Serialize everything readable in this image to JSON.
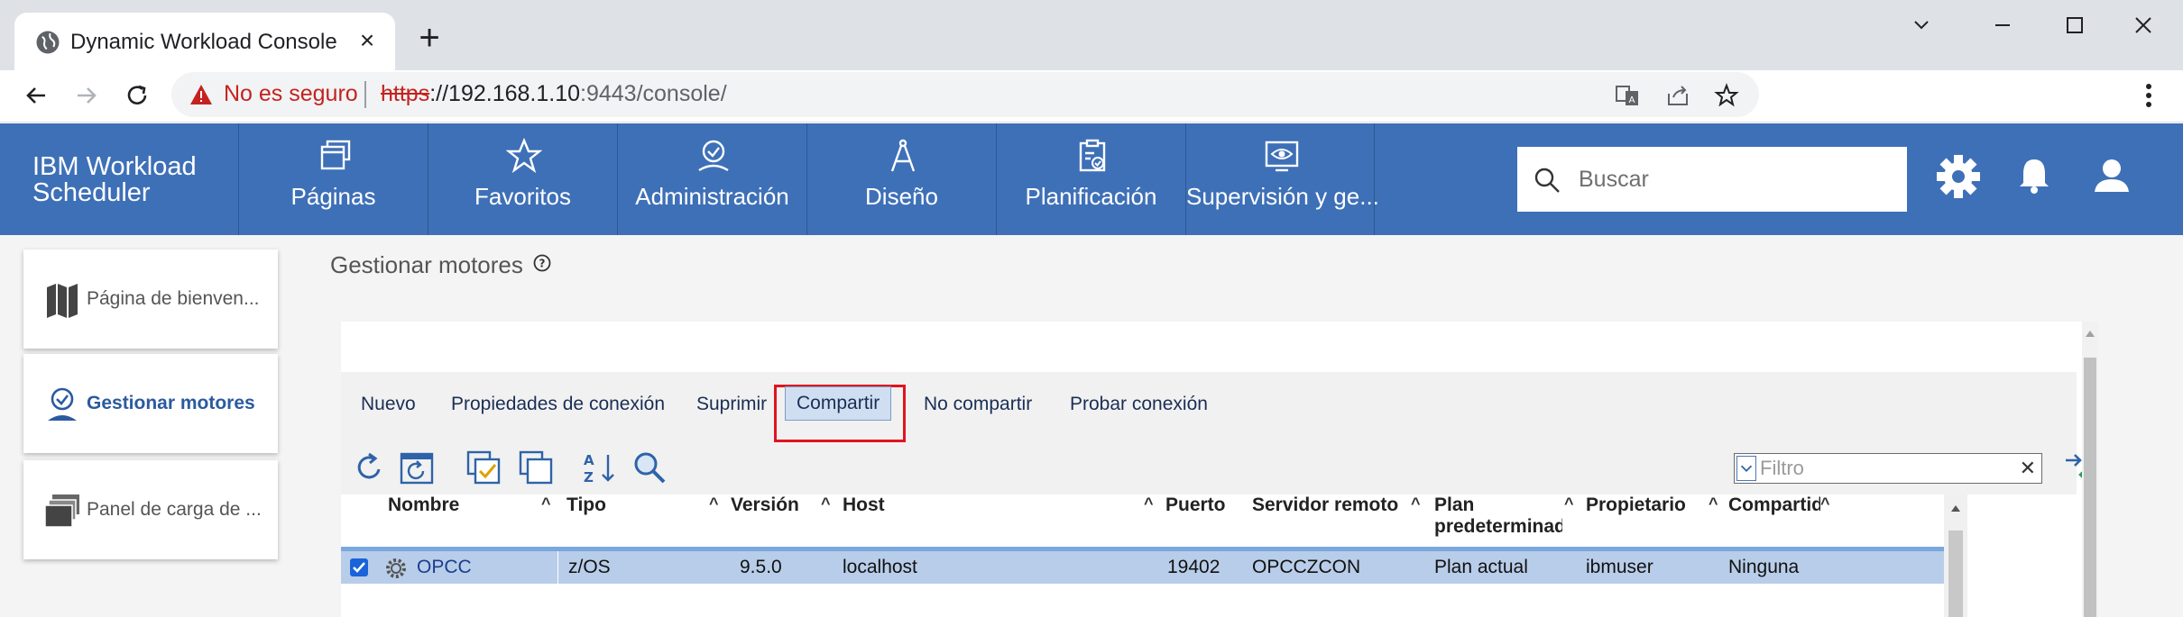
{
  "browser": {
    "tab_title": "Dynamic Workload Console",
    "security_label": "No es seguro",
    "url_scheme": "https",
    "url_host": "://192.168.1.10",
    "url_rest": ":9443/console/"
  },
  "app": {
    "brand": "IBM Workload Scheduler",
    "nav": [
      {
        "label": "Páginas",
        "icon": "pages-icon"
      },
      {
        "label": "Favoritos",
        "icon": "star-icon"
      },
      {
        "label": "Administración",
        "icon": "admin-icon"
      },
      {
        "label": "Diseño",
        "icon": "compass-icon"
      },
      {
        "label": "Planificación",
        "icon": "clipboard-icon"
      },
      {
        "label": "Supervisión y ge...",
        "icon": "monitor-eye-icon"
      }
    ],
    "search_placeholder": "Buscar",
    "accent_color": "#3e70b7"
  },
  "sidebar": {
    "items": [
      {
        "label": "Página de bienven..."
      },
      {
        "label": "Gestionar motores"
      },
      {
        "label": "Panel de carga de ..."
      }
    ]
  },
  "main": {
    "title": "Gestionar motores",
    "actions": {
      "new": "Nuevo",
      "conn_props": "Propiedades de conexión",
      "delete": "Suprimir",
      "share": "Compartir",
      "unshare": "No compartir",
      "test_conn": "Probar conexión"
    },
    "filter_placeholder": "Filtro",
    "filter_clear": "✕",
    "columns": {
      "name": "Nombre",
      "type": "Tipo",
      "version": "Versión",
      "host": "Host",
      "port": "Puerto",
      "remote_server": "Servidor remoto",
      "default_plan_1": "Plan",
      "default_plan_2": "predeterminado",
      "owner": "Propietario",
      "shared": "Compartido"
    },
    "rows": [
      {
        "name": "OPCC",
        "type": "z/OS",
        "version": "9.5.0",
        "host": "localhost",
        "port": "19402",
        "remote_server": "OPCCZCON",
        "default_plan": "Plan actual",
        "owner": "ibmuser",
        "shared": "Ninguna"
      }
    ]
  }
}
